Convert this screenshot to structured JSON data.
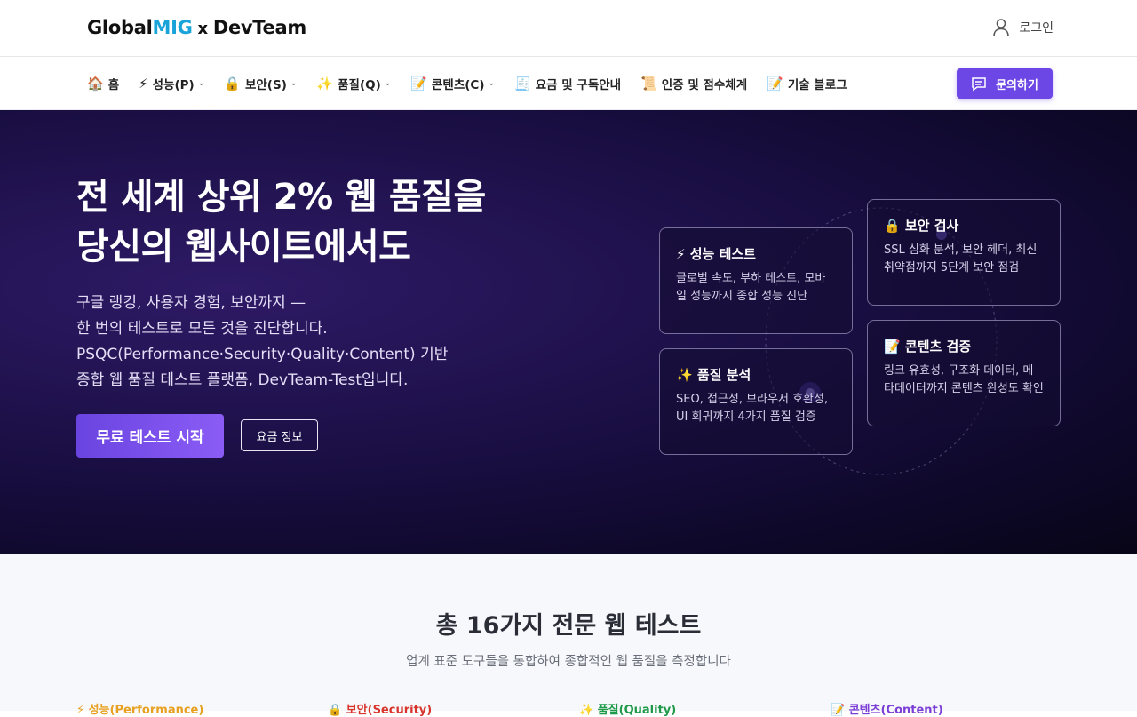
{
  "header": {
    "logo_part1": "Global",
    "logo_part2": "MIG",
    "logo_x": "x",
    "logo_part3": "DevTeam",
    "login_label": "로그인"
  },
  "nav": {
    "items": [
      {
        "icon": "🏠",
        "label": "홈"
      },
      {
        "icon": "⚡",
        "label": "성능(P)",
        "chevron": "⌄"
      },
      {
        "icon": "🔒",
        "label": "보안(S)",
        "chevron": "⌄"
      },
      {
        "icon": "✨",
        "label": "품질(Q)",
        "chevron": "⌄"
      },
      {
        "icon": "📝",
        "label": "콘텐츠(C)",
        "chevron": "⌄"
      },
      {
        "icon": "🧾",
        "label": "요금 및 구독안내"
      },
      {
        "icon": "📜",
        "label": "인증 및 점수체계"
      },
      {
        "icon": "📝",
        "label": "기술 블로그"
      }
    ],
    "contact_label": "문의하기"
  },
  "hero": {
    "title_line1": "전 세계 상위 2% 웹 품질을",
    "title_line2": "당신의 웹사이트에서도",
    "desc_line1": "구글 랭킹, 사용자 경험, 보안까지 —",
    "desc_line2": "한 번의 테스트로 모든 것을 진단합니다.",
    "desc_line3": "PSQC(Performance·Security·Quality·Content) 기반",
    "desc_line4": "종합 웹 품질 테스트 플랫폼, DevTeam-Test입니다.",
    "cta_primary": "무료 테스트 시작",
    "cta_secondary": "요금 정보",
    "cards": {
      "performance": {
        "title": "⚡ 성능 테스트",
        "desc": "글로벌 속도, 부하 테스트, 모바일 성능까지 종합 성능 진단"
      },
      "security": {
        "title": "🔒 보안 검사",
        "desc": "SSL 심화 분석, 보안 헤더, 최신 취약점까지 5단계 보안 점검"
      },
      "quality": {
        "title": "✨ 품질 분석",
        "desc": "SEO, 접근성, 브라우저 호환성, UI 회귀까지 4가지 품질 검증"
      },
      "content": {
        "title": "📝 콘텐츠 검증",
        "desc": "링크 유효성, 구조화 데이터, 메타데이터까지 콘텐츠 완성도 확인"
      }
    }
  },
  "section": {
    "title": "총 16가지 전문 웹 테스트",
    "subtitle": "업계 표준 도구들을 통합하여 종합적인 웹 품질을 측정합니다",
    "categories": [
      {
        "label": "⚡ 성능(Performance)",
        "color": "#e8a020"
      },
      {
        "label": "🔒 보안(Security)",
        "color": "#d8342c"
      },
      {
        "label": "✨ 품질(Quality)",
        "color": "#1e9a4a"
      },
      {
        "label": "📝 콘텐츠(Content)",
        "color": "#7b3fd8"
      }
    ]
  },
  "colors": {
    "accent": "#6d46e6",
    "logo_mig": "#1aa3d9",
    "hero_bg": "#1b0f45"
  }
}
